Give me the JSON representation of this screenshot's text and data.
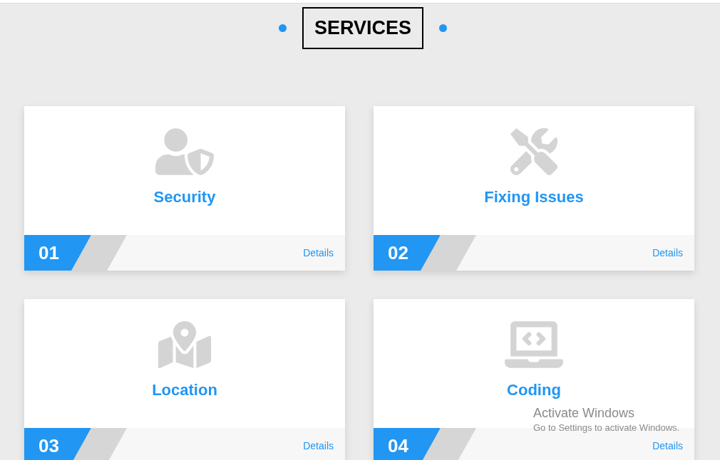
{
  "heading": "SERVICES",
  "services": [
    {
      "kind": "security",
      "title": "Security",
      "number": "01",
      "link": "Details"
    },
    {
      "kind": "tools",
      "title": "Fixing Issues",
      "number": "02",
      "link": "Details"
    },
    {
      "kind": "map",
      "title": "Location",
      "number": "03",
      "link": "Details"
    },
    {
      "kind": "code",
      "title": "Coding",
      "number": "04",
      "link": "Details"
    }
  ],
  "os_overlay": {
    "title": "Activate Windows",
    "subtitle": "Go to Settings to activate Windows."
  }
}
